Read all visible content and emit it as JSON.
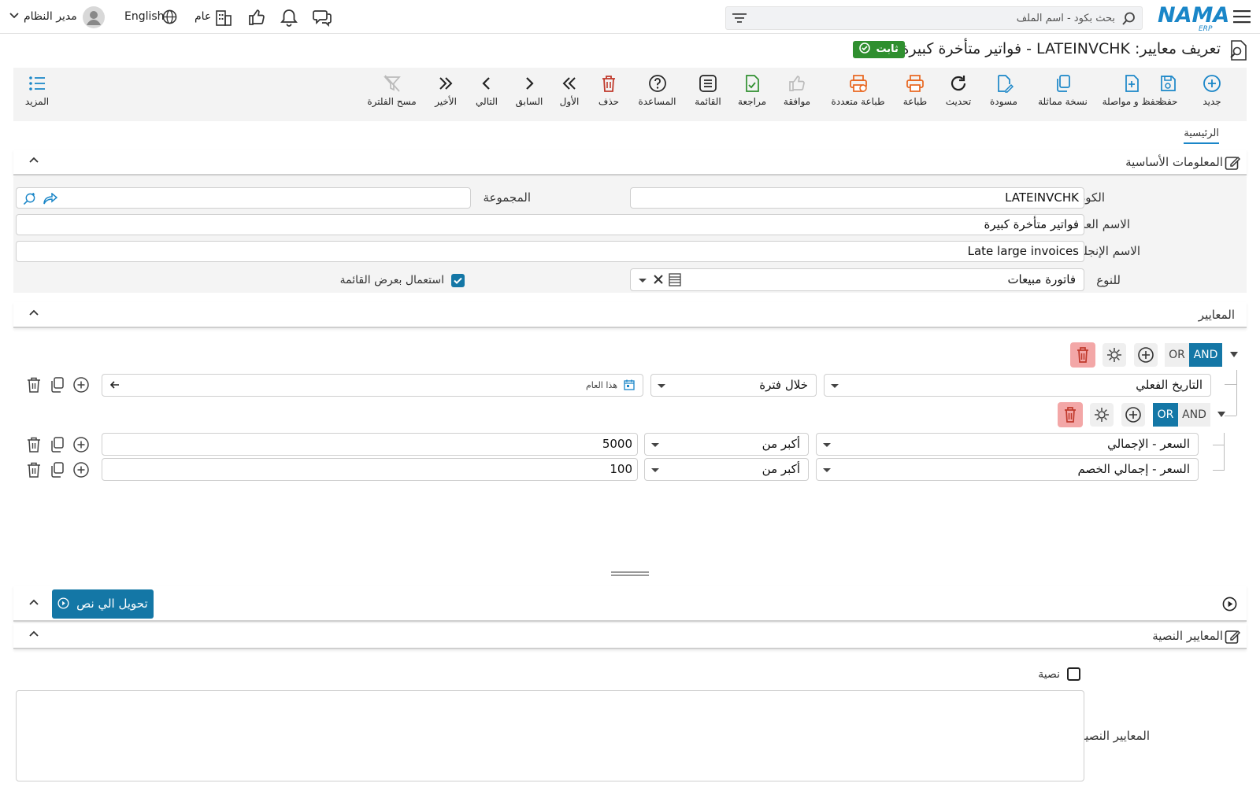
{
  "topbar": {
    "logo": "NAMA",
    "logo_sub": "ERP",
    "search_placeholder": "بحث بكود - اسم الملف",
    "user": "مدير النظام",
    "language": "English",
    "branch": "عام"
  },
  "page": {
    "title": "تعريف معايير: LATEINVCHK - فواتير متأخرة كبيرة",
    "status_badge": "ثابت"
  },
  "toolbar": {
    "items": [
      {
        "label": "جديد",
        "icon": "plus-circle-icon",
        "color": "#1a86c8"
      },
      {
        "label": "حفظ",
        "icon": "save-icon",
        "color": "#1a86c8"
      },
      {
        "label": "حفظ و مواصلة",
        "icon": "save-continue-icon",
        "color": "#1a86c8"
      },
      {
        "label": "نسخة مماثلة",
        "icon": "copy-icon",
        "color": "#1a86c8"
      },
      {
        "label": "مسودة",
        "icon": "draft-icon",
        "color": "#1a86c8"
      },
      {
        "label": "تحديث",
        "icon": "refresh-icon",
        "color": "#222"
      },
      {
        "label": "طباعة",
        "icon": "print-icon",
        "color": "#e8641c"
      },
      {
        "label": "طباعة متعددة",
        "icon": "multi-print-icon",
        "color": "#e8641c"
      },
      {
        "label": "موافقة",
        "icon": "thumbs-up-icon",
        "color": "#bbb"
      },
      {
        "label": "مراجعة",
        "icon": "review-icon",
        "color": "#2f8f2f"
      },
      {
        "label": "القائمة",
        "icon": "list-icon",
        "color": "#222"
      },
      {
        "label": "المساعدة",
        "icon": "help-icon",
        "color": "#222"
      },
      {
        "label": "حذف",
        "icon": "trash-icon",
        "color": "#c0392b"
      },
      {
        "label": "الأول",
        "icon": "first-icon",
        "color": "#222"
      },
      {
        "label": "السابق",
        "icon": "previous-icon",
        "color": "#222"
      },
      {
        "label": "التالي",
        "icon": "next-icon",
        "color": "#222"
      },
      {
        "label": "الأخير",
        "icon": "last-icon",
        "color": "#222"
      },
      {
        "label": "مسح الفلترة",
        "icon": "clear-filter-icon",
        "color": "#bbb"
      }
    ],
    "more_label": "المزيد"
  },
  "tabs": {
    "main": "الرئيسية"
  },
  "basic_info": {
    "header": "المعلومات الأساسية",
    "code_label": "الكود",
    "code_value": "LATEINVCHK",
    "group_label": "المجموعة",
    "group_value": "",
    "arabic_name_label": "الاسم العربي",
    "arabic_name_value": "فواتير متأخرة كبيرة",
    "english_name_label": "الاسم الإنجليزي",
    "english_name_value": "Late large invoices",
    "type_label": "للنوع",
    "type_value": "فاتورة مبيعات",
    "use_list_label": "استعمال بعرض القائمة",
    "use_list_checked": true
  },
  "criteria": {
    "header": "المعايير",
    "and_label": "AND",
    "or_label": "OR",
    "root_active": "AND",
    "row1": {
      "field": "التاريخ الفعلي",
      "operator": "خلال فترة",
      "value": "هذا العام"
    },
    "sub_active": "OR",
    "sub_rows": [
      {
        "field": "السعر - الإجمالي",
        "operator": "أكبر من",
        "value": "5000"
      },
      {
        "field": "السعر - إجمالي الخصم",
        "operator": "أكبر من",
        "value": "100"
      }
    ]
  },
  "convert": {
    "button": "تحويل الي نص"
  },
  "text_criteria": {
    "header": "المعايير النصية",
    "text_checkbox_label": "نصية",
    "text_checked": false,
    "field_label": "المعايير النصية",
    "field_value": ""
  }
}
